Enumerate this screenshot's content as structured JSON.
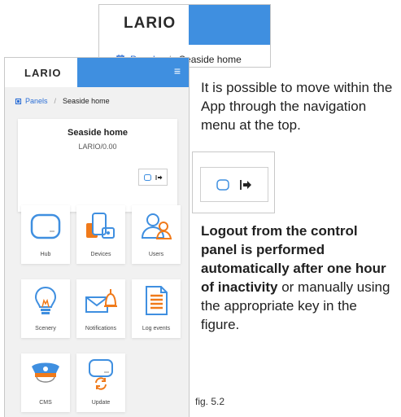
{
  "brand": {
    "logo": "LARIO"
  },
  "breadcrumb": {
    "root": "Panels",
    "separator": "/",
    "current": "Seaside home"
  },
  "home": {
    "name": "Seaside home",
    "code": "LARIO/0.00"
  },
  "tiles": [
    {
      "label": "Hub",
      "icon": "hub-icon"
    },
    {
      "label": "Devices",
      "icon": "devices-icon"
    },
    {
      "label": "Users",
      "icon": "users-icon"
    },
    {
      "label": "Scenery",
      "icon": "lightbulb-icon"
    },
    {
      "label": "Notifications",
      "icon": "bell-envelope-icon"
    },
    {
      "label": "Log events",
      "icon": "document-icon"
    },
    {
      "label": "CMS",
      "icon": "police-cap-icon"
    },
    {
      "label": "Update",
      "icon": "update-icon"
    }
  ],
  "text": {
    "nav": "It is possible to move within the App through the navigation menu at the top.",
    "logout_bold": "Logout from the control panel is performed automatically after one hour of inactivity",
    "logout_rest": "or manually using the appropriate key in the figure."
  },
  "caption": "fig. 5.2",
  "colors": {
    "accent": "#3f8fe0",
    "orange": "#f07a1a",
    "link": "#2c6fd6"
  }
}
